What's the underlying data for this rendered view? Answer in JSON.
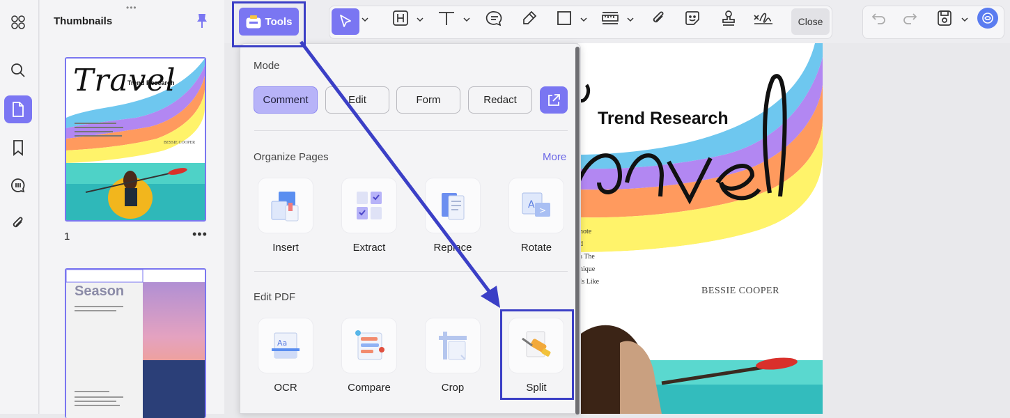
{
  "thumbnails": {
    "title": "Thumbnails",
    "page1_number": "1",
    "page1": {
      "script_title": "Travel",
      "subtitle": "Trend Research",
      "author": "BESSIE COOPER"
    },
    "page2": {
      "title": "Season"
    }
  },
  "toolbar": {
    "tools_label": "Tools",
    "close_label": "Close"
  },
  "menu": {
    "mode_title": "Mode",
    "modes": [
      "Comment",
      "Edit",
      "Form",
      "Redact"
    ],
    "active_mode": "Comment",
    "organize_title": "Organize Pages",
    "more_label": "More",
    "organize_items": [
      "Insert",
      "Extract",
      "Replace",
      "Rotate"
    ],
    "edit_title": "Edit PDF",
    "edit_items": [
      "OCR",
      "Compare",
      "Crop",
      "Split"
    ]
  },
  "document": {
    "subtitle": "Trend Research",
    "script_title": "ravel",
    "body_lines": [
      "note",
      "d",
      "s The",
      "nique",
      "Is Like"
    ],
    "author": "BESSIE COOPER"
  },
  "colors": {
    "accent": "#7a76f2",
    "annotation": "#3b3fc6",
    "rainbow": [
      "#6ec7ef",
      "#b287f2",
      "#ff9a5e",
      "#fff36a"
    ]
  }
}
